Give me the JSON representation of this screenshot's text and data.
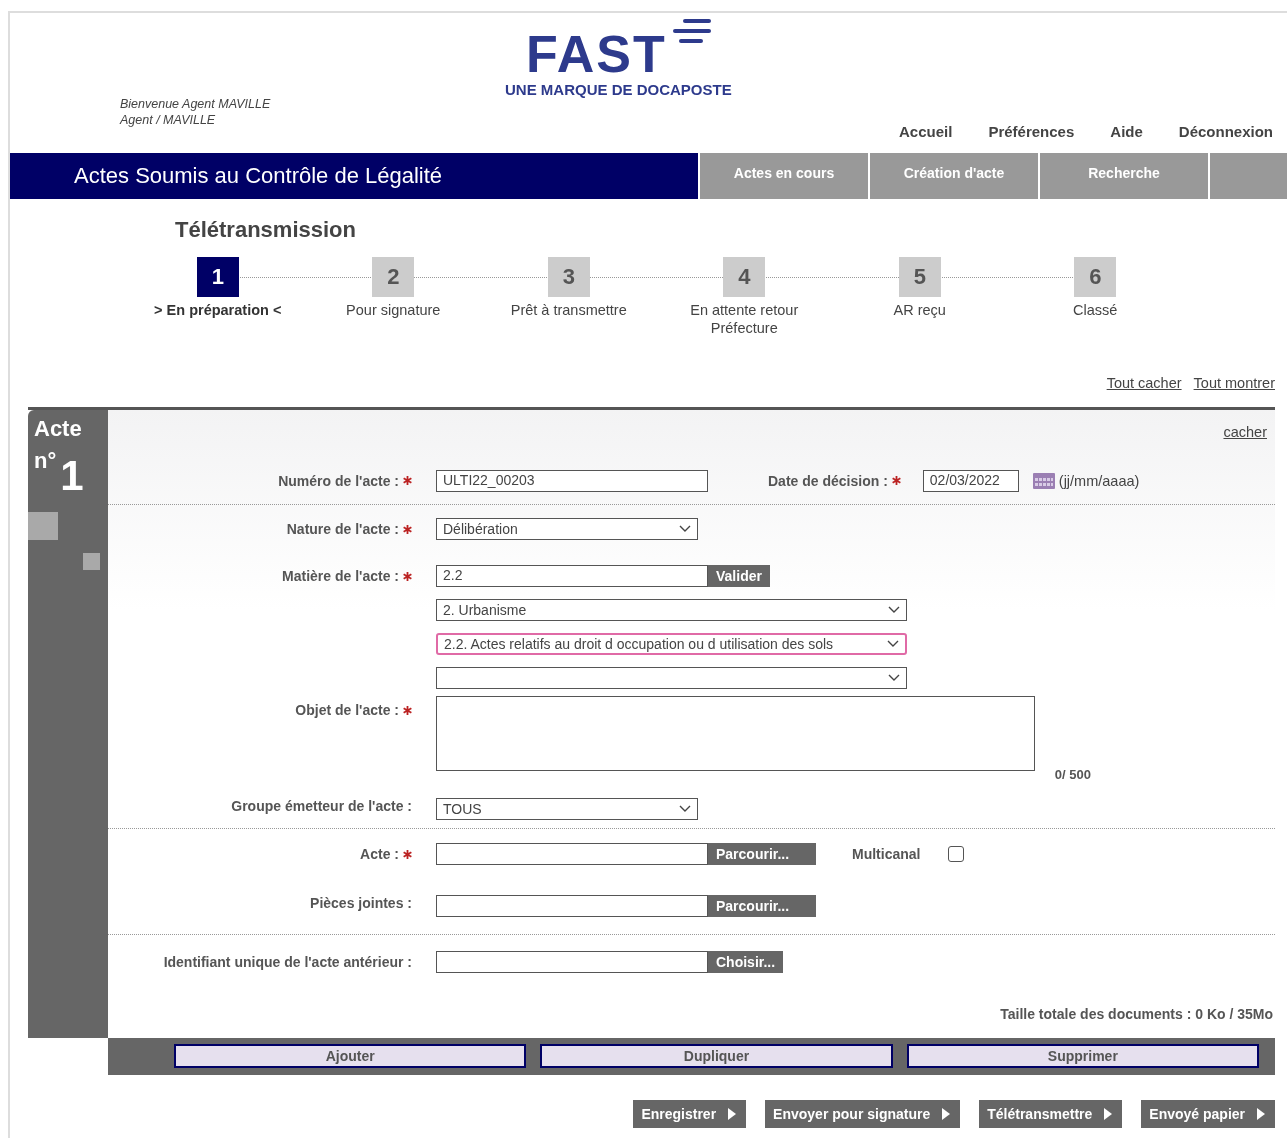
{
  "header": {
    "logo": {
      "wordmark": "FAST",
      "tagline": "UNE MARQUE DE DOCAPOSTE"
    },
    "welcome": [
      "Bienvenue Agent MAVILLE",
      "Agent / MAVILLE"
    ],
    "nav": [
      "Accueil",
      "Préférences",
      "Aide",
      "Déconnexion"
    ]
  },
  "banner": {
    "title": "Actes Soumis au Contrôle de Légalité",
    "tabs": [
      {
        "label": "Actes en cours",
        "selected": false
      },
      {
        "label": "Création d'acte",
        "selected": false
      },
      {
        "label": "Recherche",
        "selected": false
      }
    ]
  },
  "section_title": "Télétransmission",
  "steps": [
    {
      "number": "1",
      "label": "> En préparation <",
      "selected": true
    },
    {
      "number": "2",
      "label": "Pour signature",
      "selected": false
    },
    {
      "number": "3",
      "label": "Prêt à transmettre",
      "selected": false
    },
    {
      "number": "4",
      "label": "En attente retour Préfecture",
      "selected": false
    },
    {
      "number": "5",
      "label": "AR reçu",
      "selected": false
    },
    {
      "number": "6",
      "label": "Classé",
      "selected": false
    }
  ],
  "toggle_links": [
    "Tout cacher",
    "Tout montrer"
  ],
  "acte": {
    "heading": "Acte",
    "number_prefix": "n°",
    "number": "1",
    "hide_link": "cacher",
    "groups": [
      {
        "rows": [
          {
            "kind": "text",
            "label": "Numéro de l'acte :",
            "required": true,
            "value": "ULTI22_00203",
            "date": {
              "label": "Date de décision :",
              "required": true,
              "value": "02/03/2022",
              "hint": "(jj/mm/aaaa)"
            }
          }
        ]
      },
      {
        "rows": [
          {
            "kind": "select",
            "label": "Nature de l'acte :",
            "required": true,
            "value": "Délibération"
          },
          {
            "kind": "matiere",
            "label": "Matière de l'acte :",
            "required": true,
            "value": "2.2",
            "button": "Valider",
            "selects": [
              {
                "value": "2. Urbanisme",
                "highlighted": false
              },
              {
                "value": "2.2. Actes relatifs au droit d occupation ou d utilisation des sols",
                "highlighted": true
              },
              {
                "highlighted": false
              }
            ]
          },
          {
            "kind": "textarea",
            "label": "Objet de l'acte :",
            "required": true,
            "counter": "0/ 500"
          },
          {
            "kind": "select",
            "label": "Groupe émetteur de l'acte :",
            "required": false,
            "value": "TOUS"
          }
        ]
      },
      {
        "rows": [
          {
            "kind": "file",
            "label": "Acte :",
            "required": true,
            "button": "Parcourir...",
            "checkbox": {
              "label": "Multicanal",
              "checked": false
            }
          },
          {
            "kind": "file",
            "label": "Pièces jointes :",
            "required": false,
            "button": "Parcourir..."
          }
        ]
      },
      {
        "rows": [
          {
            "kind": "choose",
            "label": "Identifiant unique de l'acte antérieur :",
            "required": false,
            "button": "Choisir..."
          }
        ]
      }
    ],
    "total_size": "Taille totale des documents : 0 Ko / 35Mo",
    "actions": [
      "Ajouter",
      "Dupliquer",
      "Supprimer"
    ]
  },
  "footer_buttons": [
    "Enregistrer",
    "Envoyer pour signature",
    "Télétransmettre",
    "Envoyé papier"
  ]
}
